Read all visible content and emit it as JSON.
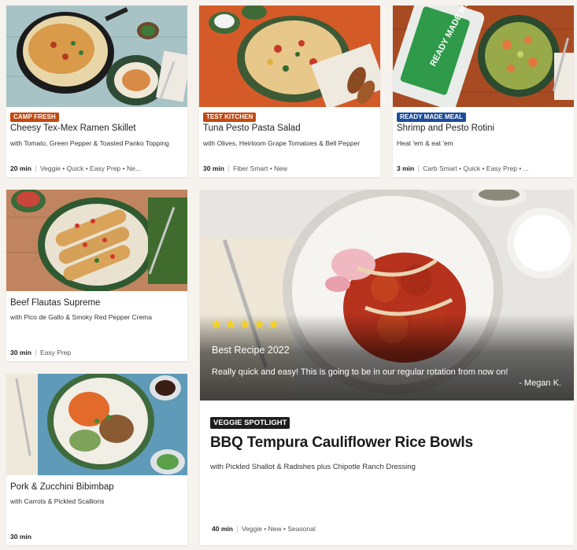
{
  "cards": [
    {
      "badge": "CAMP FRESH",
      "badge_color": "#c24a12",
      "title": "Cheesy Tex-Mex Ramen Skillet",
      "subtitle": "with Tomato, Green Pepper & Toasted Panko Topping",
      "time": "20 min",
      "tags": "Veggie • Quick • Easy Prep • Ne..."
    },
    {
      "badge": "TEST KITCHEN",
      "badge_color": "#c24a12",
      "title": "Tuna Pesto Pasta Salad",
      "subtitle": "with Olives, Heirloom Grape Tomatoes & Bell Pepper",
      "time": "30 min",
      "tags": "Fiber Smart • New"
    },
    {
      "badge": "READY MADE MEAL",
      "badge_color": "#1d4d9c",
      "title": "Shrimp and Pesto Rotini",
      "subtitle": "Heat 'em & eat 'em",
      "time": "3 min",
      "tags": "Carb Smart • Quick • Easy Prep • ..."
    },
    {
      "title": "Beef Flautas Supreme",
      "subtitle": "with Pico de Gallo & Smoky Red Pepper Crema",
      "time": "30 min",
      "tags": "Easy Prep"
    },
    {
      "title": "Pork & Zucchini Bibimbap",
      "subtitle": "with Carrots & Pickled Scallions",
      "time": "30 min"
    }
  ],
  "featured": {
    "rating": 5,
    "review_title": "Best Recipe 2022",
    "review_text": "Really quick and easy! This is going to be in our regular rotation from now on!",
    "review_author": "- Megan K.",
    "badge": "VEGGIE SPOTLIGHT",
    "title": "BBQ Tempura Cauliflower Rice Bowls",
    "subtitle": "with Pickled Shallot & Radishes plus Chipotle Ranch Dressing",
    "time": "40 min",
    "tags": "Veggie • New • Seasonal"
  },
  "ready_made_label": "READY MADE MEALS",
  "colors": {
    "star": "#f6d21c",
    "card_bg": "#ffffff",
    "page_bg": "#f6f3ee"
  }
}
